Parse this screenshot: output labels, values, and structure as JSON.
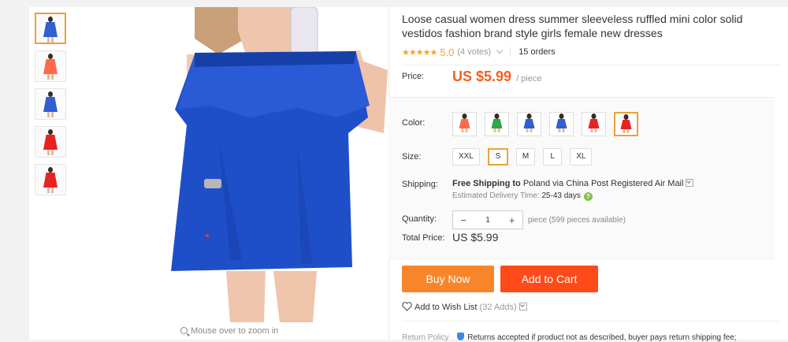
{
  "product": {
    "title": "Loose casual women dress summer sleeveless ruffled mini color solid vestidos fashion brand style girls female new dresses",
    "stars": "★★★★★",
    "rating": "5.0",
    "votes": "(4 votes)",
    "orders": "15 orders"
  },
  "gallery": {
    "thumbnails": [
      {
        "color": "#2f5fd0",
        "active": true
      },
      {
        "color": "#ff6a4d",
        "active": false
      },
      {
        "color": "#2f5fd0",
        "active": false
      },
      {
        "color": "#e8231f",
        "active": false
      },
      {
        "color": "#e8231f",
        "active": false
      }
    ],
    "zoom_hint": "Mouse over to zoom in"
  },
  "price": {
    "label": "Price:",
    "value": "US $5.99",
    "unit": "/ piece"
  },
  "color": {
    "label": "Color:",
    "options": [
      {
        "color": "#ff6a4d",
        "selected": false
      },
      {
        "color": "#2ea84a",
        "selected": false
      },
      {
        "color": "#2f5fd0",
        "selected": false
      },
      {
        "color": "#2f5fd0",
        "selected": false
      },
      {
        "color": "#e8231f",
        "selected": false
      },
      {
        "color": "#e8231f",
        "selected": true
      }
    ]
  },
  "size": {
    "label": "Size:",
    "options": [
      "XXL",
      "S",
      "M",
      "L",
      "XL"
    ],
    "selected": "S"
  },
  "shipping": {
    "label": "Shipping:",
    "free": "Free Shipping to",
    "destination": "Poland via China Post Registered Air Mail",
    "estimate_label": "Estimated Delivery Time:",
    "estimate_days": "25-43",
    "days_word": "days",
    "help": "?"
  },
  "quantity": {
    "label": "Quantity:",
    "minus": "−",
    "value": "1",
    "plus": "+",
    "available": "piece (599 pieces available)"
  },
  "total": {
    "label": "Total Price:",
    "value": "US $5.99"
  },
  "actions": {
    "buy_now": "Buy Now",
    "add_to_cart": "Add to Cart",
    "wishlist": "Add to Wish List",
    "wishlist_count": "(32 Adds)"
  },
  "return_policy": {
    "label": "Return Policy",
    "text": "Returns accepted if product not as described, buyer pays return shipping fee;"
  },
  "colors": {
    "accent_orange": "#f25f1f",
    "buy_button": "#f9852b",
    "cart_button": "#ff4a1a",
    "selected_border": "#e8a33a",
    "star": "#f5a623",
    "dress_blue": "#1f4fc8"
  }
}
